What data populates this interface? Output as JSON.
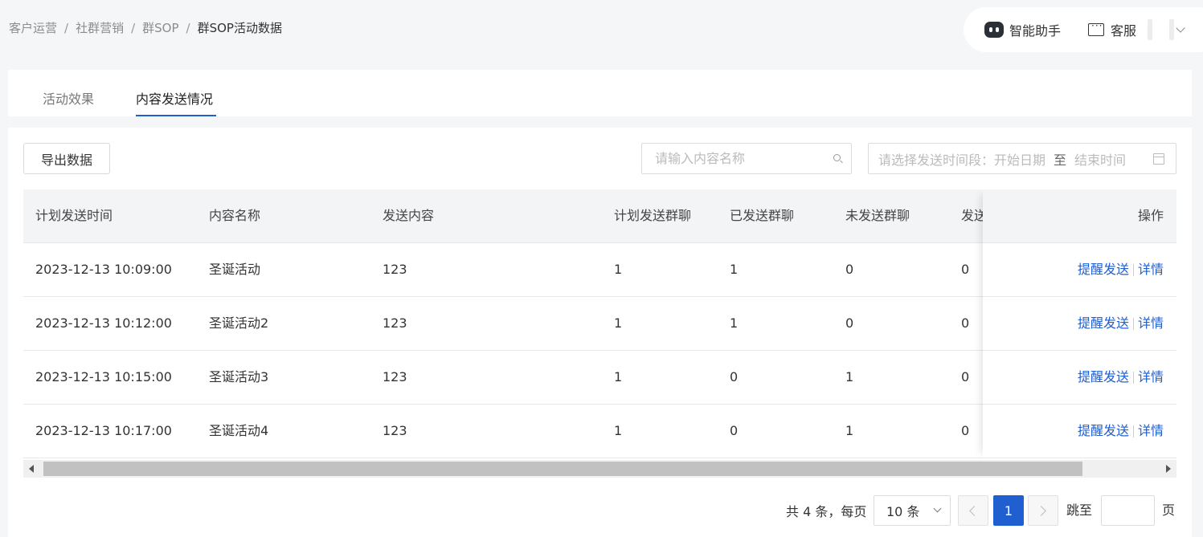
{
  "breadcrumb": {
    "items": [
      "客户运营",
      "社群营销",
      "群SOP"
    ],
    "separator": "/",
    "current": "群SOP活动数据"
  },
  "header": {
    "assistant_label": "智能助手",
    "service_label": "客服"
  },
  "tabs": [
    {
      "label": "活动效果",
      "active": false
    },
    {
      "label": "内容发送情况",
      "active": true
    }
  ],
  "toolbar": {
    "export_label": "导出数据",
    "search_placeholder": "请输入内容名称",
    "date_start_placeholder": "请选择发送时间段：开始日期",
    "date_to": "至",
    "date_end_placeholder": "结束时间"
  },
  "table": {
    "columns": [
      "计划发送时间",
      "内容名称",
      "发送内容",
      "计划发送群聊",
      "已发送群聊",
      "未发送群聊",
      "发送"
    ],
    "action_column": "操作",
    "rows": [
      {
        "time": "2023-12-13 10:09:00",
        "name": "圣诞活动",
        "content": "123",
        "planned": "1",
        "sent": "1",
        "unsent": "0",
        "other": "0"
      },
      {
        "time": "2023-12-13 10:12:00",
        "name": "圣诞活动2",
        "content": "123",
        "planned": "1",
        "sent": "1",
        "unsent": "0",
        "other": "0"
      },
      {
        "time": "2023-12-13 10:15:00",
        "name": "圣诞活动3",
        "content": "123",
        "planned": "1",
        "sent": "0",
        "unsent": "1",
        "other": "0"
      },
      {
        "time": "2023-12-13 10:17:00",
        "name": "圣诞活动4",
        "content": "123",
        "planned": "1",
        "sent": "0",
        "unsent": "1",
        "other": "0"
      }
    ],
    "actions": {
      "remind": "提醒发送",
      "detail": "详情"
    }
  },
  "pagination": {
    "total_text": "共 4 条，每页",
    "page_size": "10 条",
    "current_page": "1",
    "jump_label": "跳至",
    "page_suffix": "页"
  },
  "colors": {
    "accent": "#1f5fcf",
    "background": "#f5f6f8"
  }
}
